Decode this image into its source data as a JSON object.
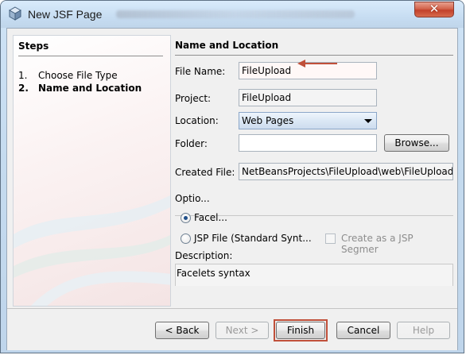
{
  "window": {
    "title": "New JSF Page",
    "close_icon": "close-icon"
  },
  "steps": {
    "heading": "Steps",
    "items": [
      {
        "number": "1.",
        "label": "Choose File Type",
        "current": false
      },
      {
        "number": "2.",
        "label": "Name and Location",
        "current": true
      }
    ]
  },
  "form": {
    "heading": "Name and Location",
    "file_name": {
      "label": "File Name:",
      "value": "FileUpload"
    },
    "project": {
      "label": "Project:",
      "value": "FileUpload"
    },
    "location": {
      "label": "Location:",
      "value": "Web Pages"
    },
    "folder": {
      "label": "Folder:",
      "value": "",
      "browse_label": "Browse..."
    },
    "created_file": {
      "label": "Created File:",
      "value": "NetBeansProjects\\FileUpload\\web\\FileUpload."
    },
    "options": {
      "heading": "Optio...",
      "facelets_label": "Facel...",
      "jsp_label": "JSP File (Standard Synt...",
      "jsp_segment_label": "Create as a JSP Segmer"
    },
    "description": {
      "label": "Description:",
      "value": "Facelets syntax"
    }
  },
  "buttons": {
    "back": "< Back",
    "next": "Next >",
    "finish": "Finish",
    "cancel": "Cancel",
    "help": "Help"
  },
  "colors": {
    "annotation_red": "#c0503a",
    "titlebar": "#c7ddf2"
  }
}
